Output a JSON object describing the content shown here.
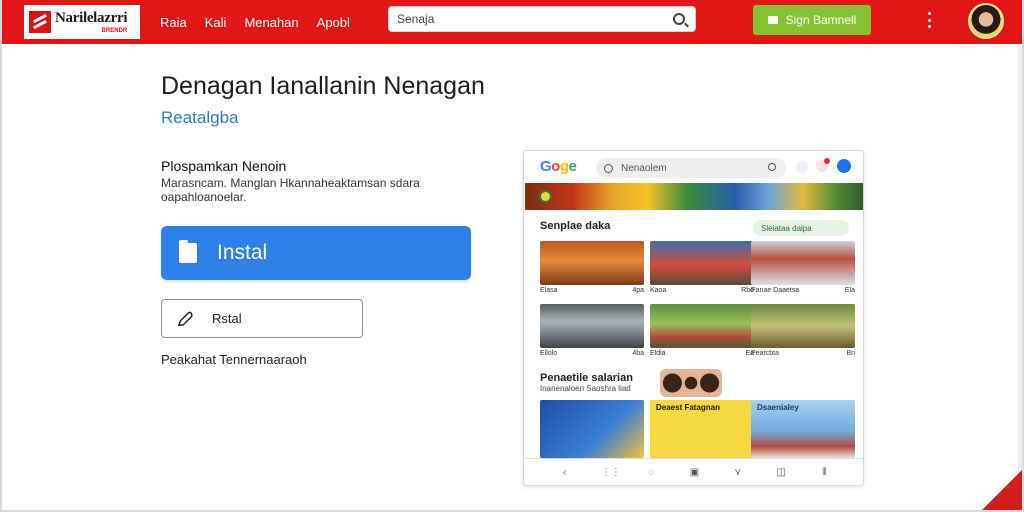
{
  "header": {
    "logo_name": "Narilelazrri",
    "logo_sub": "BRENDR",
    "nav": [
      "Raia",
      "Kali",
      "Menahan",
      "Apobl"
    ],
    "search_value": "Senaja",
    "search_placeholder": "Senaja",
    "signup_label": "Sign Bamnell"
  },
  "main": {
    "title": "Denagan Ianallanin Nenagan",
    "subtitle": "Reatalgba",
    "desc_head": "Plospamkan Nenoin",
    "desc_body": "Marasncam. Manglan Hkannaheaktamsan sdara oapahloanoelar.",
    "install_label": "Instal",
    "secondary_label": "Rstal",
    "footnote": "Peakahat Tennernaaraoh"
  },
  "phone": {
    "brand": [
      "G",
      "o",
      "g",
      "e"
    ],
    "search_text": "Nenaolem",
    "section1_title": "Senplae daka",
    "section1_pill": "Sleiataa daipa",
    "thumbs": [
      {
        "caption_left": "Elasa",
        "caption_right": "4pa"
      },
      {
        "caption_left": "Kaoa",
        "caption_right": "Rbo"
      },
      {
        "caption_left": "Panae Daaetsa",
        "caption_right": "Ela"
      },
      {
        "caption_left": "Ellolo",
        "caption_right": "4ba"
      },
      {
        "caption_left": "Eldia",
        "caption_right": "Ea"
      },
      {
        "caption_left": "Pearcbta",
        "caption_right": "Bn"
      }
    ],
    "section2_title": "Penaetile salarian",
    "section2_sub": "Inanenaloen Saoshra liad",
    "cards": [
      "",
      "Deaest Fatagnan",
      "Dsaenialey"
    ],
    "bottom_nav": [
      "‹",
      "⋮⋮",
      "◌",
      "▣",
      "⋎",
      "◫",
      "⦀"
    ]
  }
}
